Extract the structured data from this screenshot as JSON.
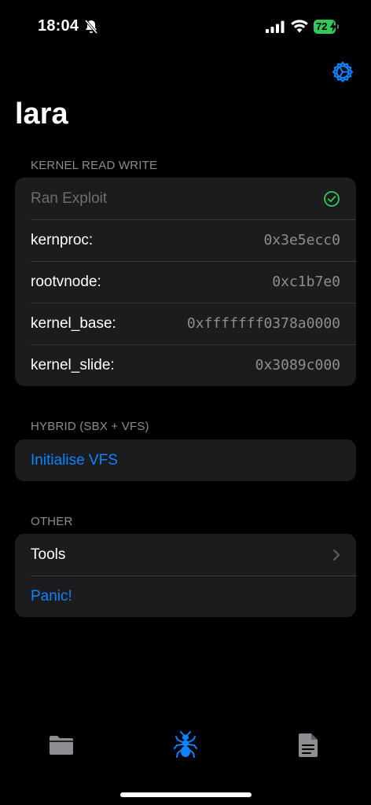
{
  "status_bar": {
    "time": "18:04",
    "battery": "72"
  },
  "nav": {
    "title": "lara"
  },
  "sections": {
    "krw": {
      "header": "KERNEL READ WRITE",
      "ran_exploit": "Ran Exploit",
      "rows": [
        {
          "label": "kernproc:",
          "value": "0x3e5ecc0"
        },
        {
          "label": "rootvnode:",
          "value": "0xc1b7e0"
        },
        {
          "label": "kernel_base:",
          "value": "0xfffffff0378a0000"
        },
        {
          "label": "kernel_slide:",
          "value": "0x3089c000"
        }
      ]
    },
    "hybrid": {
      "header": "HYBRID (SBX + VFS)",
      "initialise_vfs": "Initialise VFS"
    },
    "other": {
      "header": "OTHER",
      "tools": "Tools",
      "panic": "Panic!"
    }
  },
  "tab_bar": {
    "tabs": [
      {
        "icon": "folder-icon",
        "active": false
      },
      {
        "icon": "ant-icon",
        "active": true
      },
      {
        "icon": "document-icon",
        "active": false
      }
    ]
  },
  "colors": {
    "accent": "#0a84ff",
    "success": "#34c759",
    "background": "#000000",
    "cell": "#1c1c1e"
  }
}
